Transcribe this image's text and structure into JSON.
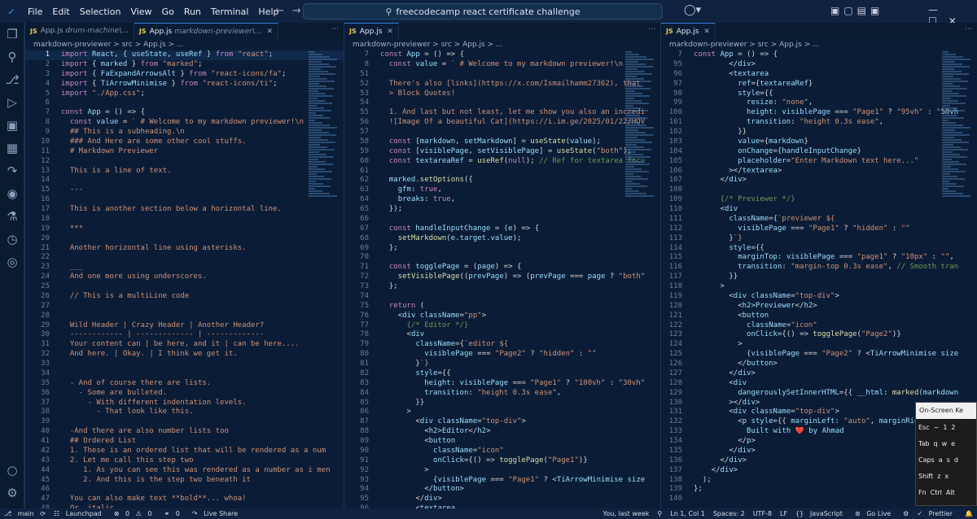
{
  "titlebar": {
    "menu": [
      "File",
      "Edit",
      "Selection",
      "View",
      "Go",
      "Run",
      "Terminal",
      "Help"
    ],
    "search": "freecodecamp react certificate challenge"
  },
  "activity_bar": [
    "files-icon",
    "search-icon",
    "source-control-icon",
    "run-debug-icon",
    "remote-explorer-icon",
    "extensions-icon",
    "live-share-icon",
    "github-icon",
    "testing-icon",
    "timeline-icon",
    "copilot-icon",
    "accounts-icon",
    "settings-icon"
  ],
  "panes": [
    {
      "tabs": [
        {
          "name": "App.js",
          "sub": "drum-machine\\...",
          "active": false
        },
        {
          "name": "App.js",
          "sub": "markdown-previewer\\...",
          "active": true
        }
      ],
      "breadcrumb": "markdown-previewer > src > App.js > ...",
      "sticky": "",
      "lines": [
        [
          "1",
          "import React, { useState, useRef } from \"react\";"
        ],
        [
          "2",
          "import { marked } from \"marked\";"
        ],
        [
          "3",
          "import { FaExpandArrowsAlt } from \"react-icons/fa\";"
        ],
        [
          "4",
          "import { TiArrowMinimise } from \"react-icons/ti\";"
        ],
        [
          "5",
          "import \"./App.css\";"
        ],
        [
          "6",
          ""
        ],
        [
          "7",
          "const App = () => {"
        ],
        [
          "8",
          "  const value = ` # Welcome to my markdown previewer!\\n"
        ],
        [
          "9",
          "  ## This is a subheading.\\n"
        ],
        [
          "10",
          "  ### And Here are some other cool stuffs."
        ],
        [
          "11",
          "  # Markdown Previewer"
        ],
        [
          "12",
          ""
        ],
        [
          "13",
          "  This is a line of text."
        ],
        [
          "14",
          ""
        ],
        [
          "15",
          "  ---"
        ],
        [
          "16",
          ""
        ],
        [
          "17",
          "  This is another section below a horizontal line."
        ],
        [
          "18",
          ""
        ],
        [
          "19",
          "  ***"
        ],
        [
          "20",
          ""
        ],
        [
          "21",
          "  Another horizontal line using asterisks."
        ],
        [
          "22",
          ""
        ],
        [
          "23",
          "  ___"
        ],
        [
          "24",
          "  And one more using underscores."
        ],
        [
          "25",
          ""
        ],
        [
          "26",
          "  // This is a multiLine code"
        ],
        [
          "27",
          ""
        ],
        [
          "28",
          ""
        ],
        [
          "29",
          "  Wild Header | Crazy Header | Another Header?"
        ],
        [
          "30",
          "  ------------ | ------------- | -------------"
        ],
        [
          "31",
          "  Your content can | be here, and it | can be here...."
        ],
        [
          "32",
          "  And here. | Okay. | I think we get it."
        ],
        [
          "33",
          ""
        ],
        [
          "34",
          ""
        ],
        [
          "35",
          "  - And of course there are lists."
        ],
        [
          "36",
          "    - Some are bulleted."
        ],
        [
          "37",
          "      - With different indentation levels."
        ],
        [
          "38",
          "        - That look like this."
        ],
        [
          "39",
          ""
        ],
        [
          "40",
          "  -And there are also number lists too"
        ],
        [
          "41",
          "  ## Ordered List"
        ],
        [
          "42",
          "  1. These is an ordered list that will be rendered as a num"
        ],
        [
          "43",
          "  2. Let me call this step two"
        ],
        [
          "44",
          "     1. As you can see this was rendered as a number as i men"
        ],
        [
          "45",
          "     2. And this is the step two beneath it"
        ],
        [
          "46",
          ""
        ],
        [
          "47",
          "  You can also make text **bold**... whoa!"
        ],
        [
          "48",
          "  Or _italic_."
        ]
      ]
    },
    {
      "tabs": [
        {
          "name": "App.js",
          "sub": "",
          "active": true
        }
      ],
      "breadcrumb": "markdown-previewer > src > App.js > ...",
      "sticky": [
        "7",
        "const App = () => {"
      ],
      "sticky2": [
        "8",
        "  const value = ` # Welcome to my markdown previewer!\\n"
      ],
      "lines": [
        [
          "51",
          ""
        ],
        [
          "52",
          "  There's also [links](https://x.com/Ismailhamm27362), that"
        ],
        [
          "53",
          "  > Block Quotes!"
        ],
        [
          "54",
          ""
        ],
        [
          "55",
          "  1. And last but not least, let me show you also an incredi"
        ],
        [
          "56",
          "  ![Image Of a beautiful Cat](https://i.im.ge/2025/01/22/HQV"
        ],
        [
          "57",
          ""
        ],
        [
          "58",
          "  const [markdown, setMarkdown] = useState(value);"
        ],
        [
          "59",
          "  const [visiblePage, setVisiblePage] = useState(\"both\");"
        ],
        [
          "60",
          "  const textareaRef = useRef(null); // Ref for textarea focu"
        ],
        [
          "61",
          ""
        ],
        [
          "62",
          "  marked.setOptions({"
        ],
        [
          "63",
          "    gfm: true,"
        ],
        [
          "64",
          "    breaks: true,"
        ],
        [
          "65",
          "  });"
        ],
        [
          "66",
          ""
        ],
        [
          "67",
          "  const handleInputChange = (e) => {"
        ],
        [
          "68",
          "    setMarkdown(e.target.value);"
        ],
        [
          "69",
          "  };"
        ],
        [
          "70",
          ""
        ],
        [
          "71",
          "  const togglePage = (page) => {"
        ],
        [
          "72",
          "    setVisiblePage((prevPage) => (prevPage === page ? \"both\""
        ],
        [
          "73",
          "  };"
        ],
        [
          "74",
          ""
        ],
        [
          "75",
          "  return ("
        ],
        [
          "76",
          "    <div className=\"pp\">"
        ],
        [
          "77",
          "      {/* Editor */}"
        ],
        [
          "78",
          "      <div"
        ],
        [
          "79",
          "        className={`editor ${"
        ],
        [
          "80",
          "          visiblePage === \"Page2\" ? \"hidden\" : \"\""
        ],
        [
          "81",
          "        }`}"
        ],
        [
          "82",
          "        style={{"
        ],
        [
          "83",
          "          height: visiblePage === \"Page1\" ? \"100vh\" : \"30vh\""
        ],
        [
          "84",
          "          transition: \"height 0.3s ease\","
        ],
        [
          "85",
          "        }}"
        ],
        [
          "86",
          "      >"
        ],
        [
          "87",
          "        <div className=\"top-div\">"
        ],
        [
          "88",
          "          <h2>Editor</h2>"
        ],
        [
          "89",
          "          <button"
        ],
        [
          "90",
          "            className=\"icon\""
        ],
        [
          "91",
          "            onClick={() => togglePage(\"Page1\")}"
        ],
        [
          "92",
          "          >"
        ],
        [
          "93",
          "            {visiblePage === \"Page1\" ? <TiArrowMinimise size"
        ],
        [
          "94",
          "          </button>"
        ],
        [
          "95",
          "        </div>"
        ],
        [
          "96",
          "        <textarea"
        ]
      ]
    },
    {
      "tabs": [
        {
          "name": "App.js",
          "sub": "",
          "active": true
        }
      ],
      "breadcrumb": "markdown-previewer > src > App.js > ...",
      "sticky": [
        "7",
        "const App = () => {"
      ],
      "lines": [
        [
          "95",
          "        </div>"
        ],
        [
          "96",
          "        <textarea"
        ],
        [
          "97",
          "          ref={textareaRef}"
        ],
        [
          "98",
          "          style={{"
        ],
        [
          "99",
          "            resize: \"none\","
        ],
        [
          "100",
          "            height: visiblePage === \"Page1\" ? \"95vh\" : \"50vh"
        ],
        [
          "101",
          "            transition: \"height 0.3s ease\","
        ],
        [
          "102",
          "          }}"
        ],
        [
          "103",
          "          value={markdown}"
        ],
        [
          "104",
          "          onChange={handleInputChange}"
        ],
        [
          "105",
          "          placeholder=\"Enter Markdown text here...\""
        ],
        [
          "106",
          "        ></textarea>"
        ],
        [
          "107",
          "      </div>"
        ],
        [
          "108",
          ""
        ],
        [
          "109",
          "      {/* Previewer */}"
        ],
        [
          "110",
          "      <div"
        ],
        [
          "111",
          "        className={`previewer ${"
        ],
        [
          "112",
          "          visiblePage === \"Page1\" ? \"hidden\" : \"\""
        ],
        [
          "113",
          "        }`}"
        ],
        [
          "114",
          "        style={{"
        ],
        [
          "115",
          "          marginTop: visiblePage === \"page1\" ? \"10px\" : \"\","
        ],
        [
          "116",
          "          transition: \"margin-top 0.3s ease\", // Smooth tran"
        ],
        [
          "117",
          "        }}"
        ],
        [
          "118",
          "      >"
        ],
        [
          "119",
          "        <div className=\"top-div\">"
        ],
        [
          "120",
          "          <h2>Previewer</h2>"
        ],
        [
          "121",
          "          <button"
        ],
        [
          "122",
          "            className=\"icon\""
        ],
        [
          "123",
          "            onClick={() => togglePage(\"Page2\")}"
        ],
        [
          "124",
          "          >"
        ],
        [
          "125",
          "            {visiblePage === \"Page2\" ? <TiArrowMinimise size"
        ],
        [
          "126",
          "          </button>"
        ],
        [
          "127",
          "        </div>"
        ],
        [
          "128",
          "        <div"
        ],
        [
          "129",
          "          dangerouslySetInnerHTML={{ __html: marked(markdown"
        ],
        [
          "130",
          "        ></div>"
        ],
        [
          "131",
          "        <div className=\"top-div\">"
        ],
        [
          "132",
          "          <p style={{ marginLeft: \"auto\", marginRight: \"a"
        ],
        [
          "133",
          "            Built with ❤️ by Ahmad"
        ],
        [
          "134",
          "          </p>"
        ],
        [
          "135",
          "        </div>"
        ],
        [
          "136",
          "      </div>"
        ],
        [
          "137",
          "    </div>"
        ],
        [
          "138",
          "  );"
        ],
        [
          "139",
          "};"
        ],
        [
          "140",
          ""
        ]
      ]
    }
  ],
  "statusbar": {
    "branch": "main",
    "launchpad": "Launchpad",
    "errors": "0",
    "warnings": "0",
    "ports": "0",
    "liveshare": "Live Share",
    "blame": "You, last week",
    "position": "Ln 1, Col 1",
    "spaces": "Spaces: 2",
    "encoding": "UTF-8",
    "eol": "LF",
    "language": "JavaScript",
    "golive": "Go Live",
    "prettier": "Prettier"
  },
  "osk": {
    "title": "On-Screen Ke",
    "row1": [
      "Esc",
      "~",
      "1",
      "2"
    ],
    "row2": [
      "Tab",
      "q",
      "w",
      "e"
    ],
    "row3": [
      "Caps",
      "a",
      "s",
      "d"
    ],
    "row4": [
      "Shift",
      "z",
      "x"
    ],
    "row5": [
      "Fn",
      "Ctrl",
      "Alt"
    ]
  }
}
